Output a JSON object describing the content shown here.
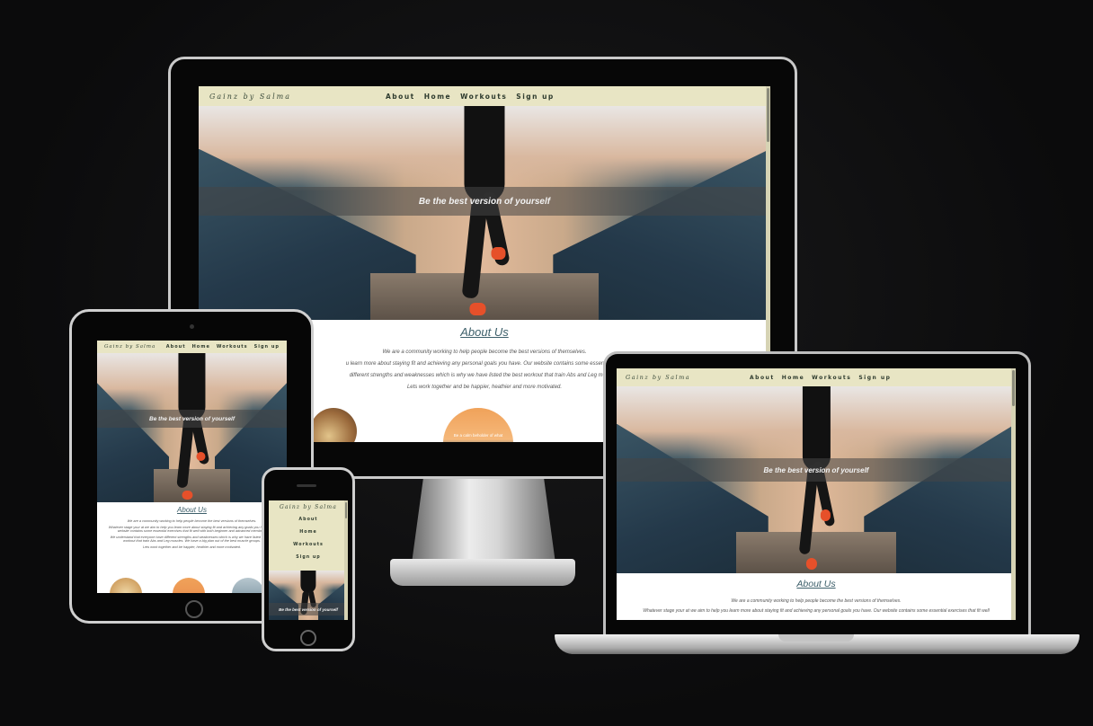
{
  "site": {
    "brand": "Gainz by Salma",
    "nav": [
      "About",
      "Home",
      "Workouts",
      "Sign up"
    ],
    "hero_tagline": "Be the best version of yourself",
    "about_title": "About Us",
    "about_p1": "We are a community working to help people become the best versions of themselves.",
    "about_p2_desktop": "u learn more about staying fit and achieving any personal goals you have. Our website contains some essential exer",
    "about_p3_desktop": "different strengths and weaknesses which is why we have listed the best workout that train Abs and Leg muscles.",
    "about_p4": "Lets work together and be happier, heathier and more motivated.",
    "circle_caption": "Be a calm beholder of what",
    "tablet_p2": "Whatever stage your at we aim to help you learn more about staying fit and achieving any goals you have. Our website contains some essential exercises that fit well with both beginner and advanced members.",
    "tablet_p3": "We understand that everyone have different strengths and weaknesses which is why we have listed the best workout that train Abs and Leg muscles. We have a big plan out of the best muscle groups.",
    "tablet_p4": "Lets work together and be happier, heathier and more motivated.",
    "laptop_p2": "Whatever stage your at we aim to help you learn more about staying fit and achieving any personal goals you have. Our website contains some essential exercises that fit well"
  },
  "colors": {
    "nav_bg": "#e8e5c4",
    "brand_text": "#3a4a3a",
    "heading": "#3d5f6a",
    "background": "#0c0c0d"
  },
  "devices": [
    "monitor",
    "tablet",
    "phone",
    "laptop"
  ]
}
